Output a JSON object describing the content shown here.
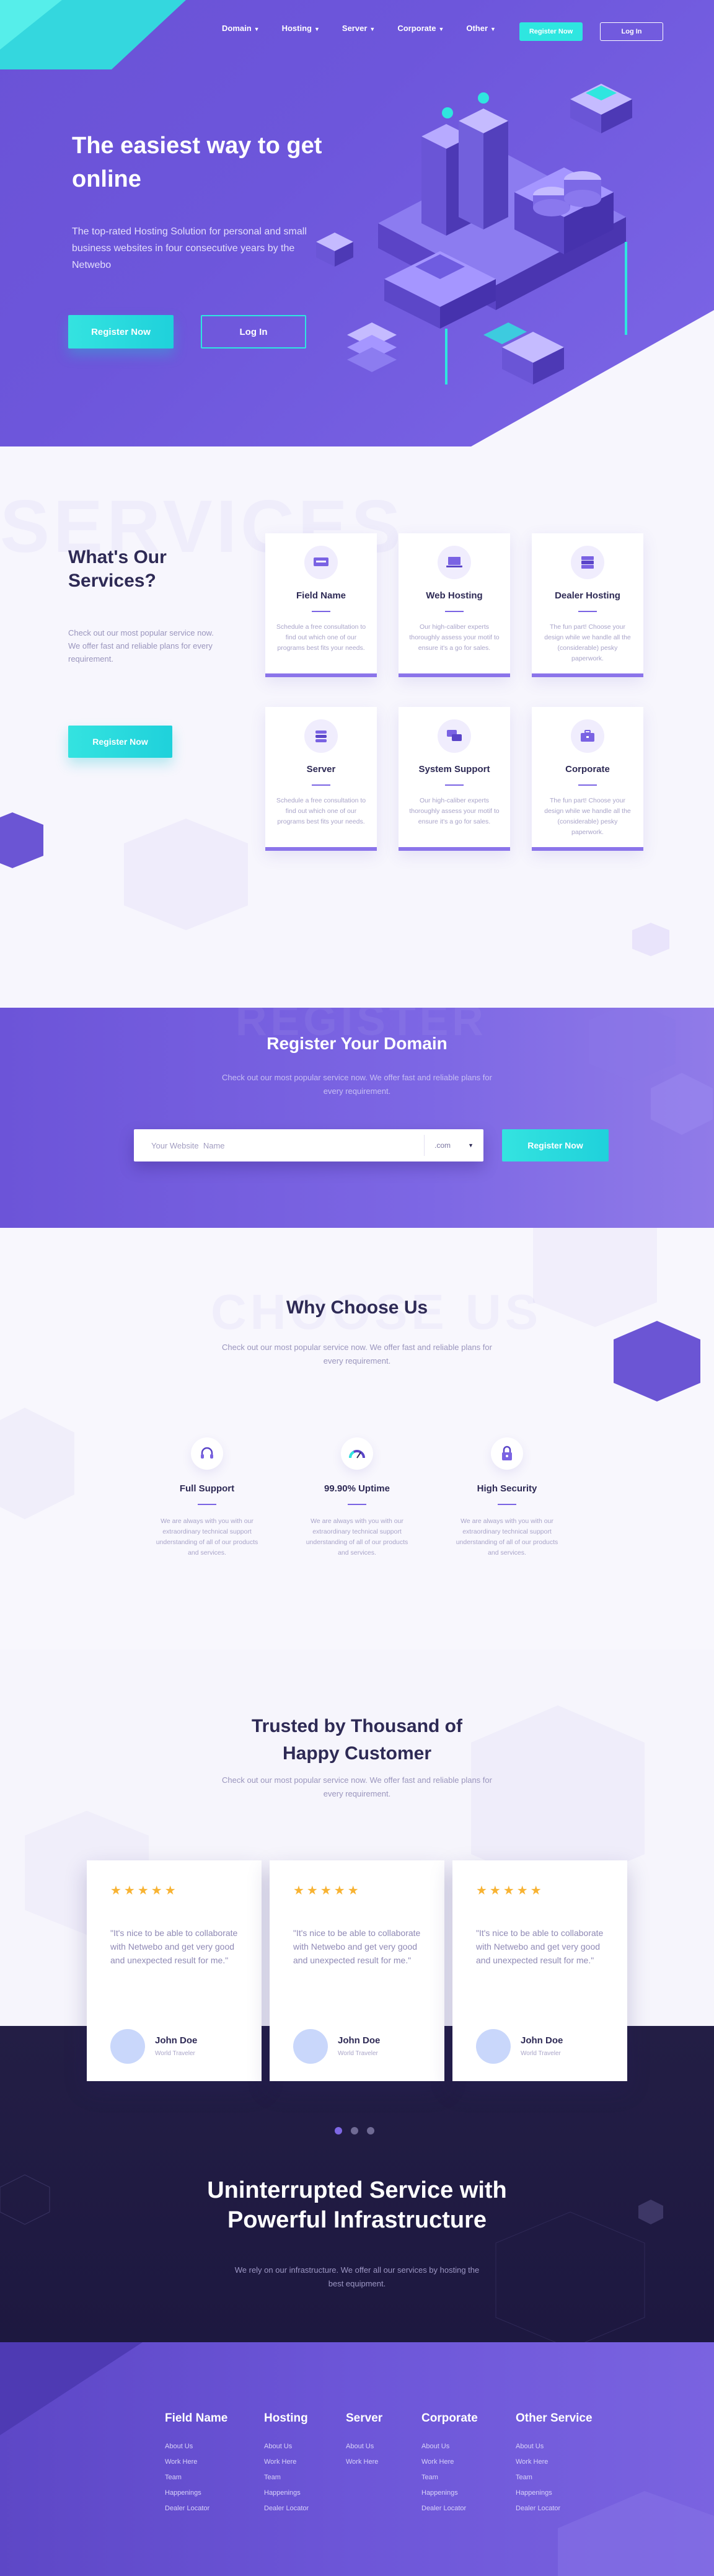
{
  "nav": {
    "items": [
      {
        "label": "Domain"
      },
      {
        "label": "Hosting"
      },
      {
        "label": "Server"
      },
      {
        "label": "Corporate"
      },
      {
        "label": "Other"
      }
    ],
    "register_label": "Register Now",
    "login_label": "Log In"
  },
  "hero": {
    "title": "The easiest way to get online",
    "subtitle": "The top-rated Hosting Solution for personal and small business websites in four consecutive years by the Netwebo",
    "register_label": "Register Now",
    "login_label": "Log In"
  },
  "services": {
    "bg_word": "SERVICES",
    "title": "What's Our Services?",
    "description": "Check out our most popular service now. We offer fast and reliable plans for every requirement.",
    "button_label": "Register Now",
    "cards": [
      {
        "title": "Field Name",
        "text": "Schedule a free consultation to find out which one of our programs best fits your needs.",
        "icon": "server-panel-icon"
      },
      {
        "title": "Web Hosting",
        "text": "Our high-caliber experts thoroughly assess your motif to ensure it's a go for sales.",
        "icon": "laptop-icon"
      },
      {
        "title": "Dealer Hosting",
        "text": "The fun part! Choose your design while we handle all the (considerable) pesky paperwork.",
        "icon": "server-rack-icon"
      },
      {
        "title": "Server",
        "text": "Schedule a free consultation to find out which one of our programs best fits your needs.",
        "icon": "database-icon"
      },
      {
        "title": "System Support",
        "text": "Our high-caliber experts thoroughly assess your motif to ensure it's a go for sales.",
        "icon": "chat-icon"
      },
      {
        "title": "Corporate",
        "text": "The fun part! Choose your design while we handle all the (considerable) pesky paperwork.",
        "icon": "briefcase-icon"
      }
    ]
  },
  "domain": {
    "bg_word": "REGISTER",
    "title": "Register Your Domain",
    "subtitle": "Check out our most popular service now. We offer fast and reliable plans for every requirement.",
    "input_placeholder": "Your Website  Name",
    "tld": ".com",
    "button_label": "Register Now"
  },
  "why": {
    "bg_word": "CHOOSE US",
    "title": "Why Choose Us",
    "subtitle": "Check out our most popular service now. We offer fast and reliable plans for every requirement.",
    "features": [
      {
        "title": "Full Support",
        "text": "We are always with you with our extraordinary technical support understanding of all of our products and services.",
        "icon": "headset-icon"
      },
      {
        "title": "99.90% Uptime",
        "text": "We are always with you with our extraordinary technical support understanding of all of our products and services.",
        "icon": "speedometer-icon"
      },
      {
        "title": "High Security",
        "text": "We are always with you with our extraordinary technical support understanding of all of our products and services.",
        "icon": "lock-icon"
      }
    ]
  },
  "trust": {
    "title": "Trusted by Thousand of Happy Customer",
    "subtitle": "Check out our most popular service now. We offer fast and reliable plans for every requirement.",
    "testimonials": [
      {
        "stars": "★★★★★",
        "quote": "\"It's nice to be able to collaborate with Netwebo and get very good and unexpected result for me.\"",
        "author": "John Doe",
        "role": "World Traveler"
      },
      {
        "stars": "★★★★★",
        "quote": "\"It's nice to be able to collaborate with Netwebo and get very good and unexpected result for me.\"",
        "author": "John Doe",
        "role": "World Traveler"
      },
      {
        "stars": "★★★★★",
        "quote": "\"It's nice to be able to collaborate with Netwebo and get very good and unexpected result for me.\"",
        "author": "John Doe",
        "role": "World Traveler"
      }
    ]
  },
  "infra": {
    "title": "Uninterrupted Service with Powerful Infrastructure",
    "subtitle": "We rely on our infrastructure. We offer all our services by hosting the best equipment."
  },
  "footer": {
    "columns": [
      {
        "title": "Field Name",
        "links": [
          "About Us",
          "Work Here",
          "Team",
          "Happenings",
          "Dealer Locator"
        ]
      },
      {
        "title": "Hosting",
        "links": [
          "About Us",
          "Work Here",
          "Team",
          "Happenings",
          "Dealer Locator"
        ]
      },
      {
        "title": "Server",
        "links": [
          "About Us",
          "Work Here"
        ]
      },
      {
        "title": "Corporate",
        "links": [
          "About Us",
          "Work Here",
          "Team",
          "Happenings",
          "Dealer Locator"
        ]
      },
      {
        "title": "Other Service",
        "links": [
          "About Us",
          "Work Here",
          "Team",
          "Happenings",
          "Dealer Locator"
        ]
      }
    ]
  },
  "colors": {
    "primary": "#6c54d8",
    "accent": "#2ee6e0",
    "dark": "#211c44",
    "star": "#f8b333"
  }
}
